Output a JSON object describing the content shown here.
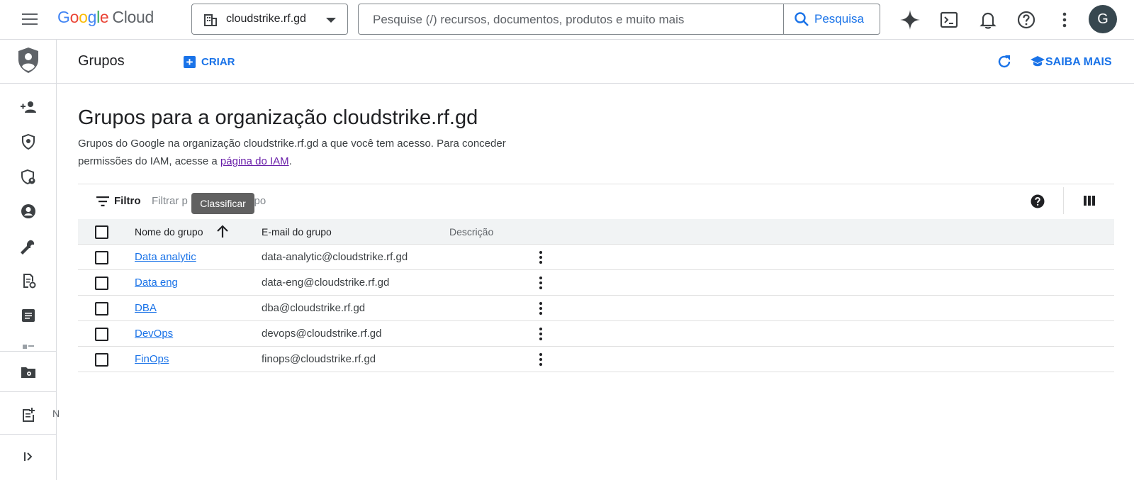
{
  "topbar": {
    "logo": {
      "google": "Google",
      "cloud": "Cloud"
    },
    "project_name": "cloudstrike.rf.gd",
    "search_placeholder": "Pesquise (/) recursos, documentos, produtos e muito mais",
    "search_button": "Pesquisa",
    "avatar_letter": "G",
    "icons": [
      "menu-icon",
      "building-icon",
      "dropdown-arrow-icon",
      "search-icon",
      "gemini-sparkle-icon",
      "cloud-shell-icon",
      "notifications-bell-icon",
      "help-icon",
      "more-vert-icon"
    ]
  },
  "rail": {
    "icons": [
      "iam-shield-icon",
      "person-add-icon",
      "policy-shield-icon",
      "security-shield-icon",
      "account-circle-icon",
      "wrench-icon",
      "document-settings-icon",
      "list-box-icon",
      "partial-icon",
      "folder-settings-icon",
      "note-add-icon",
      "expand-panel-icon"
    ],
    "partial_label": "N"
  },
  "header": {
    "title": "Grupos",
    "create_label": "CRIAR",
    "learn_more_label": "SAIBA MAIS"
  },
  "main": {
    "heading": "Grupos para a organização cloudstrike.rf.gd",
    "description_before": "Grupos do Google na organização cloudstrike.rf.gd a que você tem acesso. Para conceder permissões do IAM, acesse a ",
    "description_link": "página do IAM",
    "description_after": "."
  },
  "filter": {
    "label": "Filtro",
    "placeholder_start": "Filtrar p",
    "placeholder_end": "grupo",
    "tooltip": "Classificar"
  },
  "table": {
    "columns": [
      "Nome do grupo",
      "E-mail do grupo",
      "Descrição"
    ],
    "sort": "ascending",
    "rows": [
      {
        "name": "Data analytic",
        "email": "data-analytic@cloudstrike.rf.gd",
        "description": ""
      },
      {
        "name": "Data eng",
        "email": "data-eng@cloudstrike.rf.gd",
        "description": ""
      },
      {
        "name": "DBA",
        "email": "dba@cloudstrike.rf.gd",
        "description": ""
      },
      {
        "name": "DevOps",
        "email": "devops@cloudstrike.rf.gd",
        "description": ""
      },
      {
        "name": "FinOps",
        "email": "finops@cloudstrike.rf.gd",
        "description": ""
      }
    ]
  },
  "colors": {
    "accent": "#1a73e8",
    "link_visited": "#681da8",
    "avatar_bg": "#37474f"
  }
}
